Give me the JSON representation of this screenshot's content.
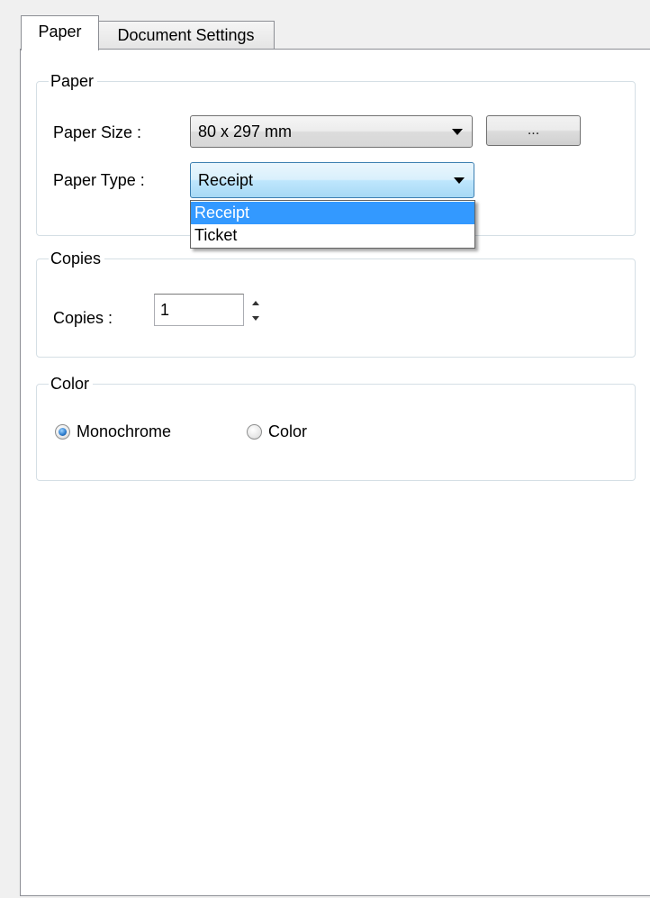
{
  "tabs": [
    {
      "label": "Paper",
      "active": true
    },
    {
      "label": "Document Settings",
      "active": false
    }
  ],
  "paper_group": {
    "legend": "Paper",
    "paper_size_label": "Paper Size :",
    "paper_size_value": "80 x 297 mm",
    "browse_button_label": "...",
    "paper_type_label": "Paper Type :",
    "paper_type_value": "Receipt",
    "paper_type_options": [
      {
        "label": "Receipt",
        "selected": true
      },
      {
        "label": "Ticket",
        "selected": false
      }
    ]
  },
  "copies_group": {
    "legend": "Copies",
    "copies_label": "Copies :",
    "copies_value": "1"
  },
  "color_group": {
    "legend": "Color",
    "options": [
      {
        "label": "Monochrome",
        "checked": true
      },
      {
        "label": "Color",
        "checked": false
      }
    ]
  },
  "colors": {
    "selection_highlight": "#3399ff",
    "focus_border": "#3c7fb1",
    "panel_background": "#ffffff",
    "window_background": "#f0f0f0"
  },
  "icons": {
    "dropdown_arrow": "chevron-down-icon",
    "spin_up": "arrow-up-icon",
    "spin_down": "arrow-down-icon"
  }
}
